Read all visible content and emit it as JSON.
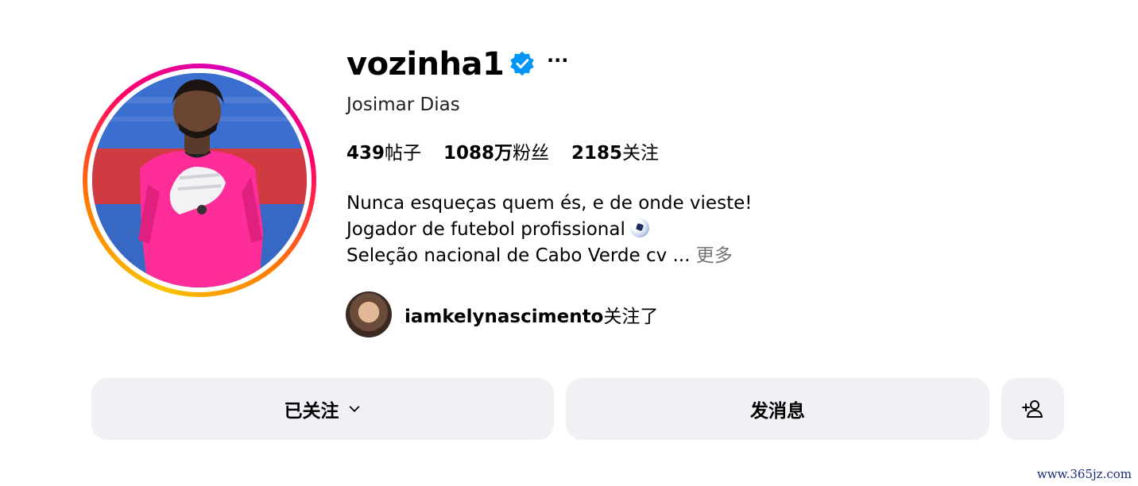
{
  "profile": {
    "username": "vozinha1",
    "verified": true,
    "more_label": "···",
    "full_name": "Josimar Dias",
    "stats": {
      "posts_count": "439",
      "posts_label": "帖子",
      "followers_count": "1088万",
      "followers_label": "粉丝",
      "following_count": "2185",
      "following_label": "关注"
    },
    "bio": {
      "line1": "Nunca esqueças quem és, e de onde vieste!",
      "line2": "Jogador de futebol profissional",
      "line2_icon": "soccer-ball-icon",
      "line3": "Seleção nacional de Cabo Verde cv ...",
      "more_link": "更多"
    },
    "followed_by": {
      "username": "iamkelynascimento",
      "suffix": "关注了"
    }
  },
  "actions": {
    "following_button": "已关注",
    "message_button": "发消息",
    "add_user_icon": "add-user-icon"
  },
  "watermark": "www.365jz.com",
  "colors": {
    "verified_blue": "#0095f6",
    "button_bg": "#eff1f5",
    "muted_text": "#737373"
  }
}
